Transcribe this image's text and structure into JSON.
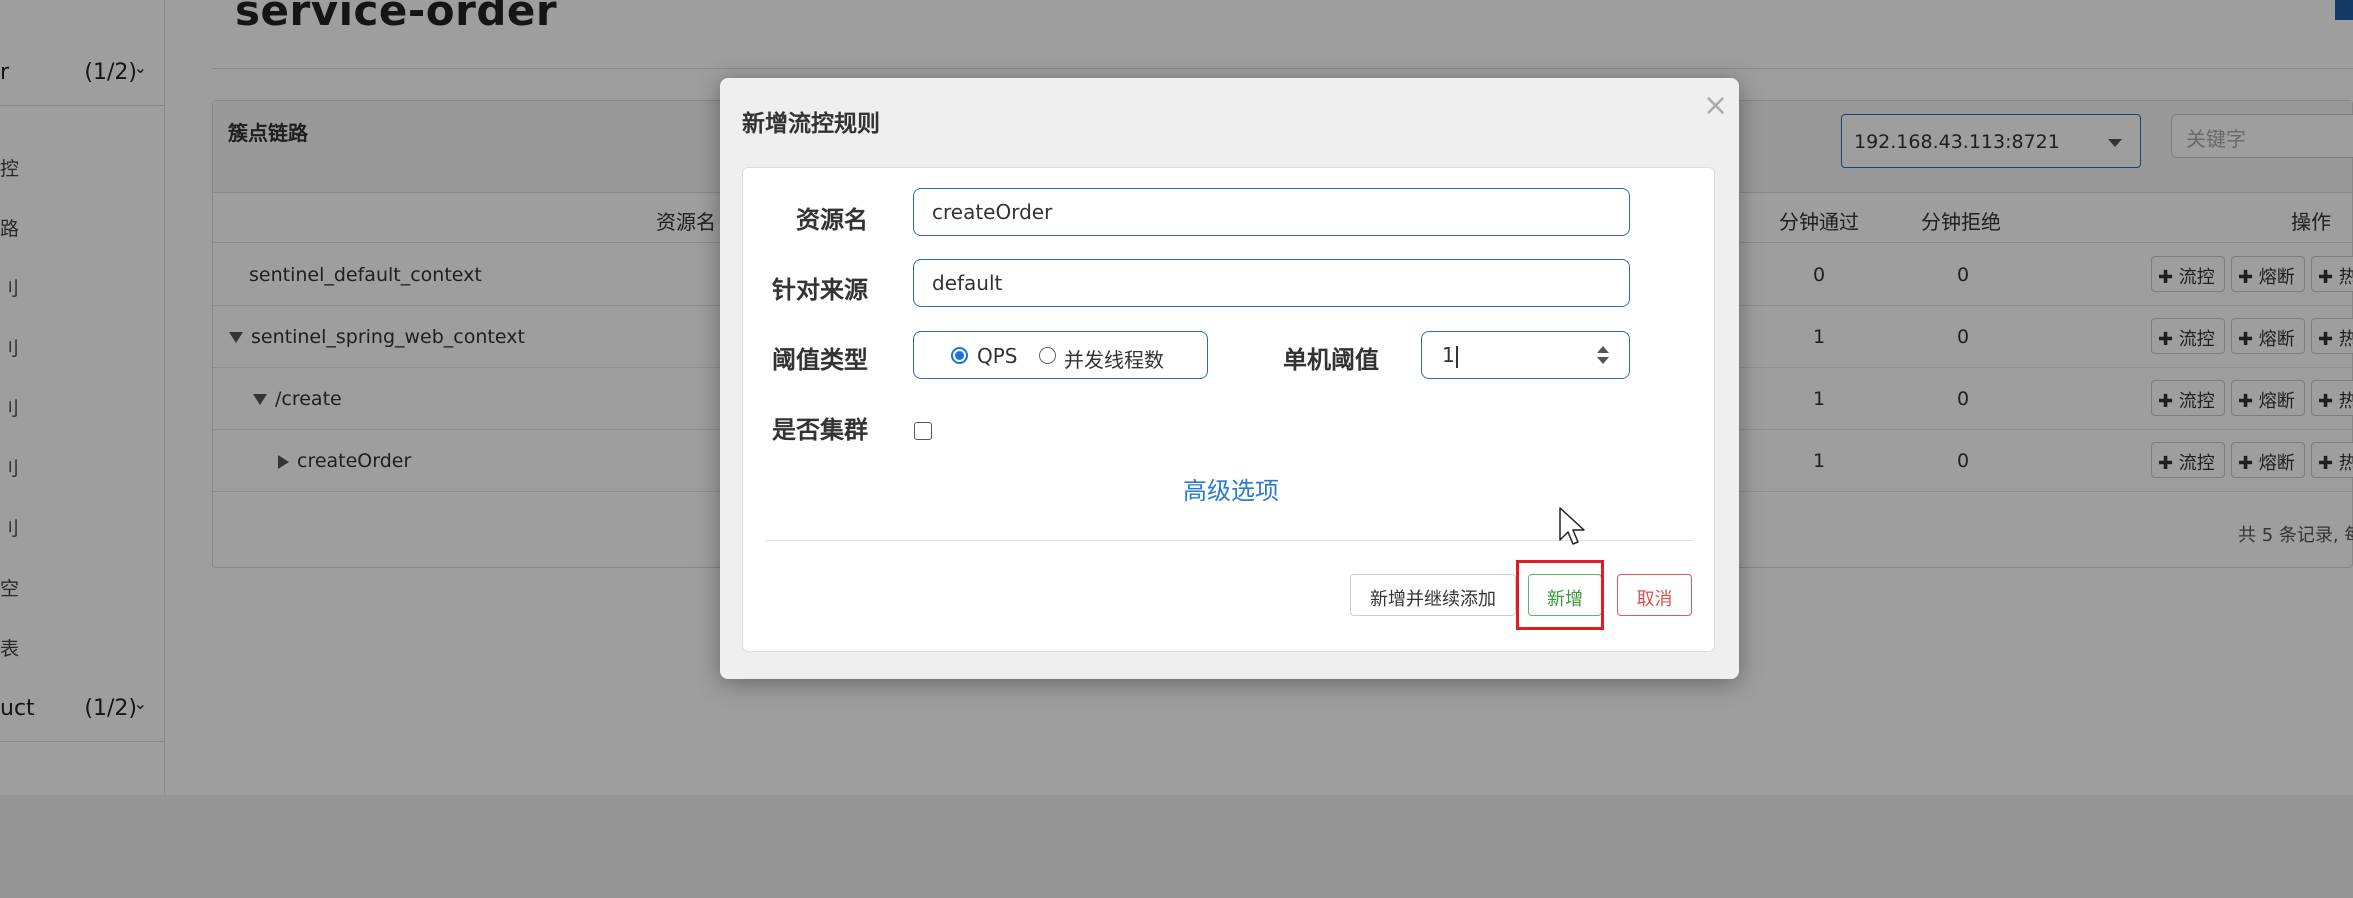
{
  "page": {
    "title": "service-order"
  },
  "sidebar": {
    "apps": [
      {
        "name": "r",
        "count": "(1/2)"
      },
      {
        "name": "uct",
        "count": "(1/2)"
      }
    ],
    "menu_items": [
      "控",
      "路",
      "刂",
      "刂",
      "刂",
      "刂",
      "刂",
      "空",
      "表"
    ]
  },
  "panel": {
    "title": "簇点链路",
    "ip_select": "192.168.43.113:8721",
    "keyword_placeholder": "关键字",
    "columns": {
      "resource": "资源名",
      "pass_min": "分钟通过",
      "reject_min": "分钟拒绝",
      "ops": "操作"
    },
    "rows": [
      {
        "name": "sentinel_default_context",
        "pass": "0",
        "reject": "0"
      },
      {
        "name": "sentinel_spring_web_context",
        "pass": "1",
        "reject": "0"
      },
      {
        "name": "/create",
        "pass": "1",
        "reject": "0"
      },
      {
        "name": "createOrder",
        "pass": "1",
        "reject": "0"
      }
    ],
    "op_buttons": {
      "flow": "✚ 流控",
      "degrade": "✚ 熔断",
      "hot": "✚ 热"
    },
    "pager": "共 5 条记录, 每"
  },
  "modal": {
    "title": "新增流控规则",
    "close": "×",
    "fields": {
      "resource_label": "资源名",
      "resource_value": "createOrder",
      "source_label": "针对来源",
      "source_value": "default",
      "threshold_type_label": "阈值类型",
      "qps_option": "QPS",
      "thread_option": "并发线程数",
      "threshold_label": "单机阈值",
      "threshold_value": "1",
      "cluster_label": "是否集群"
    },
    "advanced_link": "高级选项",
    "buttons": {
      "add_continue": "新增并继续添加",
      "add": "新增",
      "cancel": "取消"
    }
  }
}
